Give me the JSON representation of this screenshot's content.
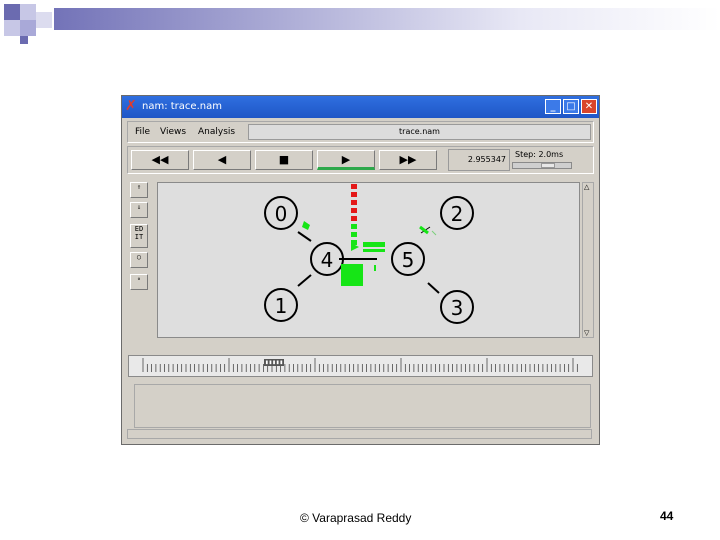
{
  "window": {
    "title": "nam: trace.nam",
    "minimize_glyph": "_",
    "maximize_glyph": "□",
    "close_glyph": "✕"
  },
  "menu": {
    "file": "File",
    "views": "Views",
    "analysis": "Analysis",
    "filename": "trace.nam"
  },
  "controls": {
    "rewind": "◀◀",
    "back": "◀",
    "stop": "■",
    "play": "▶",
    "fastforward": "▶▶",
    "time": "2.955347",
    "step_label": "Step: 2.0ms"
  },
  "tools": {
    "edit": "ED IT"
  },
  "nodes": {
    "n0": "0",
    "n1": "1",
    "n2": "2",
    "n3": "3",
    "n4": "4",
    "n5": "5"
  },
  "colors": {
    "packet_green": "#16e516",
    "packet_red": "#e41818",
    "titlebar": "#1f56c6"
  },
  "slide": {
    "footer": "© Varaprasad Reddy",
    "page_number": "44"
  }
}
